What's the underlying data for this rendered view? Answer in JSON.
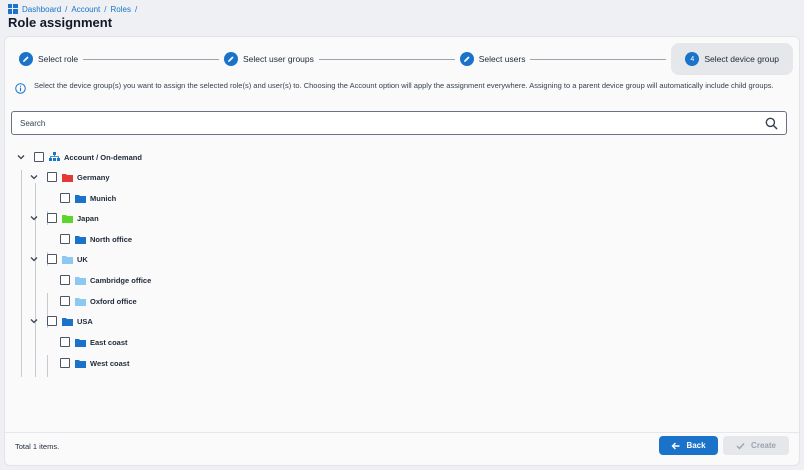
{
  "breadcrumb": {
    "items": [
      "Dashboard",
      "Account",
      "Roles"
    ],
    "separator": "/"
  },
  "page": {
    "title": "Role assignment"
  },
  "stepper": {
    "steps": [
      {
        "label": "Select role",
        "state": "done",
        "icon": "pencil-icon"
      },
      {
        "label": "Select user groups",
        "state": "done",
        "icon": "pencil-icon"
      },
      {
        "label": "Select users",
        "state": "done",
        "icon": "pencil-icon"
      },
      {
        "label": "Select device group",
        "state": "active",
        "number": "4"
      }
    ]
  },
  "info": {
    "text": "Select the device group(s) you want to assign the selected role(s) and user(s) to. Choosing the Account option will apply the assignment everywhere. Assigning to a parent device group will automatically include child groups."
  },
  "search": {
    "placeholder": "Search",
    "value": ""
  },
  "tree": {
    "root": {
      "label": "Account / On-demand",
      "icon": "hierarchy-icon"
    },
    "groups": [
      {
        "label": "Germany",
        "color": "#e53935",
        "children": [
          {
            "label": "Munich",
            "color": "#1a73c9"
          }
        ]
      },
      {
        "label": "Japan",
        "color": "#5ad62c",
        "children": [
          {
            "label": "North office",
            "color": "#1a73c9"
          }
        ]
      },
      {
        "label": "UK",
        "color": "#8cc8f0",
        "children": [
          {
            "label": "Cambridge office",
            "color": "#8cc8f0"
          },
          {
            "label": "Oxford office",
            "color": "#8cc8f0"
          }
        ]
      },
      {
        "label": "USA",
        "color": "#1a73c9",
        "children": [
          {
            "label": "East coast",
            "color": "#1a73c9"
          },
          {
            "label": "West coast",
            "color": "#1a73c9"
          }
        ]
      }
    ]
  },
  "footer": {
    "total": "Total 1 items.",
    "back_label": "Back",
    "create_label": "Create"
  },
  "colors": {
    "accent": "#1a73c9",
    "disabled": "#e5e7eb"
  }
}
